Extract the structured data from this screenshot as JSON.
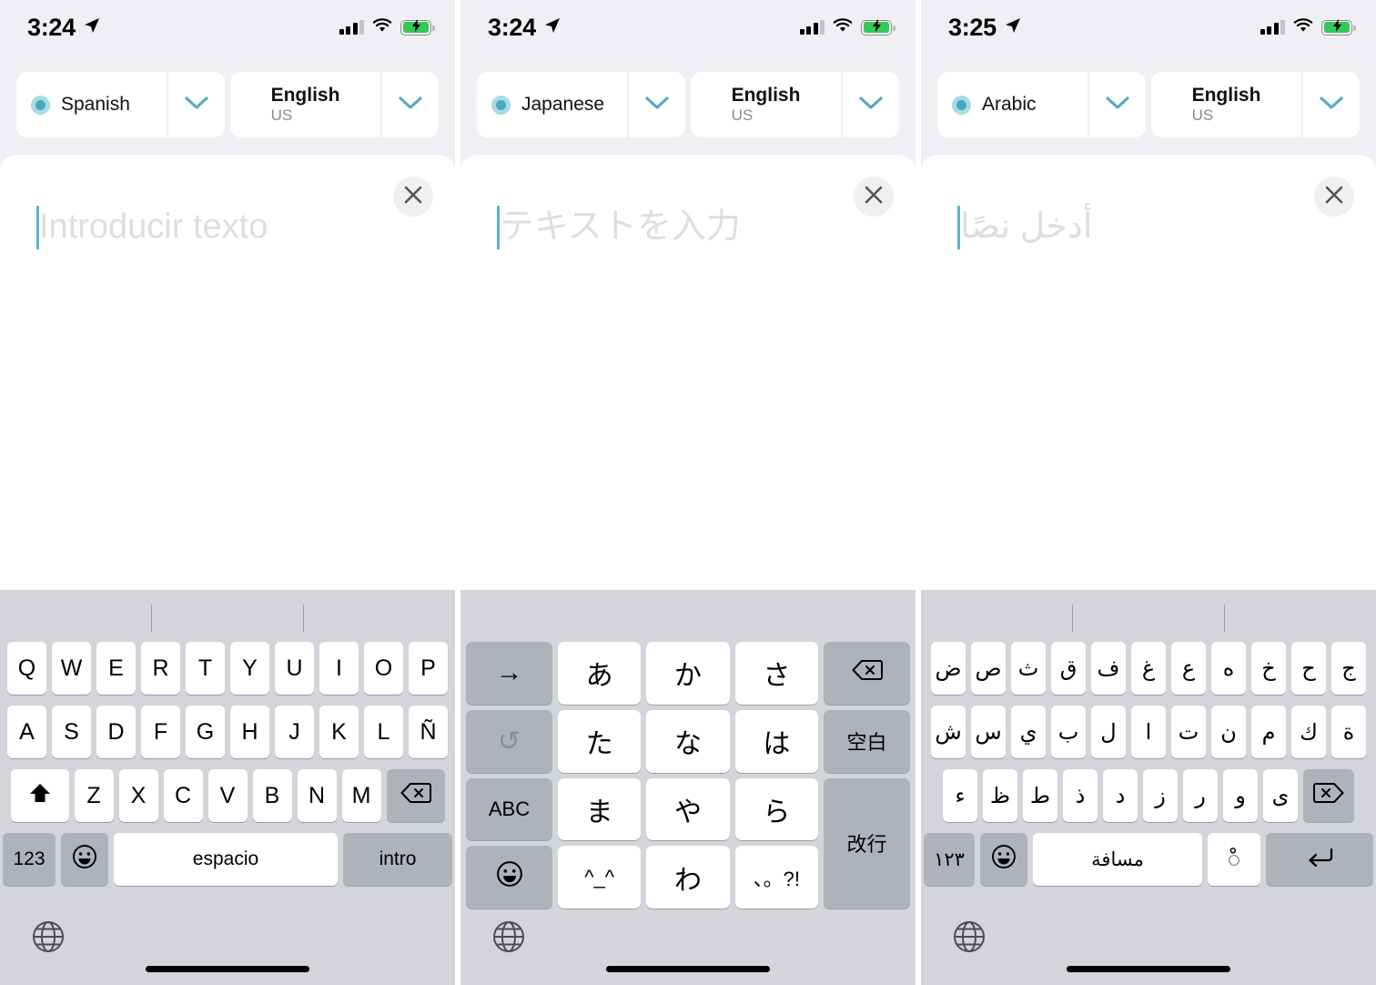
{
  "theme": {
    "panel_bg": "#f0f0f4",
    "card_bg": "#ffffff",
    "keyboard_bg": "#d3d5da",
    "key_light": "#ffffff",
    "key_dark": "#aeb2bb",
    "accent_radio_ring": "#a8dbe4",
    "accent_radio_dot": "#4ba7bd",
    "caret": "#5fb3c9",
    "placeholder_text": "#dedede",
    "battery_green": "#34c759"
  },
  "panels": [
    {
      "id": "spanish",
      "status": {
        "time": "3:24",
        "location_icon": "location-arrow-icon",
        "signal_icon": "cellular-signal-icon",
        "signal_bars": 3,
        "signal_total": 4,
        "wifi_icon": "wifi-icon",
        "battery_icon": "battery-charging-icon"
      },
      "source_lang": {
        "name": "Spanish",
        "sub": "",
        "chevron": "chevron-down-icon"
      },
      "target_lang": {
        "name": "English",
        "sub": "US",
        "chevron": "chevron-down-icon"
      },
      "clear_button": {
        "icon": "close-icon",
        "label": "✕"
      },
      "input": {
        "placeholder": "Introducir texto",
        "value": "",
        "rtl": false
      },
      "keyboard": {
        "type": "qwerty-es",
        "suggestion_dividers": 2,
        "row1": [
          "Q",
          "W",
          "E",
          "R",
          "T",
          "Y",
          "U",
          "I",
          "O",
          "P"
        ],
        "row2": [
          "A",
          "S",
          "D",
          "F",
          "G",
          "H",
          "J",
          "K",
          "L",
          "Ñ"
        ],
        "row3_letters": [
          "Z",
          "X",
          "C",
          "V",
          "B",
          "N",
          "M"
        ],
        "shift_icon": "shift-icon",
        "delete_icon": "delete-left-icon",
        "numbers_label": "123",
        "emoji_icon": "emoji-smiley-icon",
        "space_label": "espacio",
        "return_label": "intro",
        "globe_icon": "globe-icon"
      }
    },
    {
      "id": "japanese",
      "status": {
        "time": "3:24",
        "location_icon": "location-arrow-icon",
        "signal_icon": "cellular-signal-icon",
        "signal_bars": 3,
        "signal_total": 4,
        "wifi_icon": "wifi-icon",
        "battery_icon": "battery-charging-icon"
      },
      "source_lang": {
        "name": "Japanese",
        "sub": "",
        "chevron": "chevron-down-icon"
      },
      "target_lang": {
        "name": "English",
        "sub": "US",
        "chevron": "chevron-down-icon"
      },
      "clear_button": {
        "icon": "close-icon",
        "label": "✕"
      },
      "input": {
        "placeholder": "テキストを入力",
        "value": "",
        "rtl": false
      },
      "keyboard": {
        "type": "kana-12key",
        "suggestion_dividers": 0,
        "grid": [
          {
            "label": "→",
            "style": "dark",
            "name": "cursor-right-key"
          },
          {
            "label": "あ",
            "style": "light",
            "name": "kana-a-key"
          },
          {
            "label": "か",
            "style": "light",
            "name": "kana-ka-key"
          },
          {
            "label": "さ",
            "style": "light",
            "name": "kana-sa-key"
          },
          {
            "label": "⌫",
            "style": "dark",
            "name": "delete-left-key"
          },
          {
            "label": "↺",
            "style": "dark-disabled",
            "name": "undo-key"
          },
          {
            "label": "た",
            "style": "light",
            "name": "kana-ta-key"
          },
          {
            "label": "な",
            "style": "light",
            "name": "kana-na-key"
          },
          {
            "label": "は",
            "style": "light",
            "name": "kana-ha-key"
          },
          {
            "label": "空白",
            "style": "dark-small",
            "name": "space-key"
          },
          {
            "label": "ABC",
            "style": "dark-small",
            "name": "abc-key"
          },
          {
            "label": "ま",
            "style": "light",
            "name": "kana-ma-key"
          },
          {
            "label": "や",
            "style": "light",
            "name": "kana-ya-key"
          },
          {
            "label": "ら",
            "style": "light",
            "name": "kana-ra-key"
          },
          {
            "label": "改行",
            "style": "dark-small-span2",
            "name": "return-key"
          },
          {
            "label": "☺",
            "style": "dark",
            "name": "emoji-smiley-key"
          },
          {
            "label": "^_^",
            "style": "light-small",
            "name": "kaomoji-key"
          },
          {
            "label": "わ",
            "style": "light",
            "name": "kana-wa-key"
          },
          {
            "label": "、。?!",
            "style": "light-small",
            "name": "punctuation-key"
          }
        ],
        "globe_icon": "globe-icon"
      }
    },
    {
      "id": "arabic",
      "status": {
        "time": "3:25",
        "location_icon": "location-arrow-icon",
        "signal_icon": "cellular-signal-icon",
        "signal_bars": 3,
        "signal_total": 4,
        "wifi_icon": "wifi-icon",
        "battery_icon": "battery-charging-icon"
      },
      "source_lang": {
        "name": "Arabic",
        "sub": "",
        "chevron": "chevron-down-icon"
      },
      "target_lang": {
        "name": "English",
        "sub": "US",
        "chevron": "chevron-down-icon"
      },
      "clear_button": {
        "icon": "close-icon",
        "label": "✕"
      },
      "input": {
        "placeholder": "أدخل نصًا",
        "value": "",
        "rtl": true
      },
      "keyboard": {
        "type": "arabic",
        "suggestion_dividers": 2,
        "row1": [
          "ض",
          "ص",
          "ث",
          "ق",
          "ف",
          "غ",
          "ع",
          "ه",
          "خ",
          "ح",
          "ج"
        ],
        "row2": [
          "ش",
          "س",
          "ي",
          "ب",
          "ل",
          "ا",
          "ت",
          "ن",
          "م",
          "ك",
          "ة"
        ],
        "row3_letters": [
          "ء",
          "ظ",
          "ط",
          "ذ",
          "د",
          "ز",
          "ر",
          "و",
          "ى"
        ],
        "delete_icon": "delete-right-icon",
        "numbers_label": "١٢٣",
        "emoji_icon": "emoji-smiley-icon",
        "space_label": "مسافة",
        "diacritic_label": "ْ◌",
        "return_icon": "return-arrow-icon",
        "globe_icon": "globe-icon"
      }
    }
  ]
}
